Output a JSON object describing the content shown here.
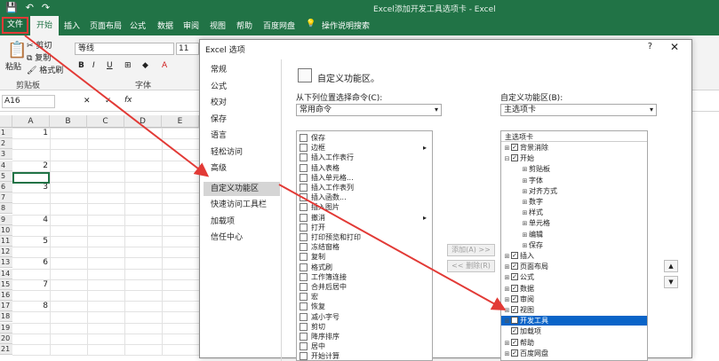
{
  "window_title": "Excel添加开发工具选项卡 - Excel",
  "qat": {
    "save": "💾",
    "undo": "↶",
    "redo": "↷"
  },
  "tabs": {
    "file": "文件",
    "home": "开始",
    "insert": "插入",
    "layout": "页面布局",
    "formulas": "公式",
    "data": "数据",
    "review": "审阅",
    "view": "视图",
    "help": "帮助",
    "baidu": "百度网盘",
    "tellme": "操作说明搜索"
  },
  "ribbon": {
    "paste": "粘贴",
    "cut": "剪切",
    "copy": "复制",
    "format_painter": "格式刷",
    "clipboard_group": "剪贴板",
    "font_name": "等线",
    "font_size": "11",
    "font_group": "字体",
    "bold": "B",
    "italic": "I",
    "underline": "U",
    "font_color": "A"
  },
  "formula": {
    "namebox": "A16",
    "cancel": "✕",
    "enter": "✓",
    "fx": "fx"
  },
  "sheet": {
    "columns": [
      "A",
      "B",
      "C",
      "D",
      "E"
    ],
    "rows": [
      "1",
      "2",
      "3",
      "4",
      "5",
      "6",
      "7",
      "8",
      "9",
      "10",
      "11",
      "12",
      "13",
      "14",
      "15",
      "16",
      "17",
      "18",
      "19",
      "20",
      "21"
    ],
    "values": [
      {
        "row": 1,
        "value": "1"
      },
      {
        "row": 4,
        "value": "2"
      },
      {
        "row": 6,
        "value": "3"
      },
      {
        "row": 9,
        "value": "4"
      },
      {
        "row": 11,
        "value": "5"
      },
      {
        "row": 13,
        "value": "6"
      },
      {
        "row": 15,
        "value": "7"
      },
      {
        "row": 17,
        "value": "8"
      }
    ]
  },
  "dialog": {
    "title": "Excel 选项",
    "help": "?",
    "close": "✕",
    "nav": [
      "常规",
      "公式",
      "校对",
      "保存",
      "语言",
      "轻松访问",
      "高级",
      "自定义功能区",
      "快速访问工具栏",
      "加载项",
      "信任中心"
    ],
    "header": "自定义功能区。",
    "left_label": "从下列位置选择命令(C):",
    "left_combo": "常用命令",
    "commands": [
      "保存",
      "边框",
      "插入工作表行",
      "插入表格",
      "插入单元格...",
      "插入工作表列",
      "插入函数...",
      "插入图片",
      "撤消",
      "打开",
      "打印预览和打印",
      "冻结窗格",
      "复制",
      "格式刷",
      "工作簿连接",
      "合并后居中",
      "宏",
      "恢复",
      "减小字号",
      "剪切",
      "降序排序",
      "居中",
      "开始计算"
    ],
    "add_button": "添加(A) >>",
    "remove_button": "<< 删除(R)",
    "right_label": "自定义功能区(B):",
    "right_combo": "主选项卡",
    "tree_header": "主选项卡",
    "tree": [
      {
        "label": "背景消除",
        "level": 0,
        "exp": "⊞",
        "checked": true
      },
      {
        "label": "开始",
        "level": 0,
        "exp": "⊟",
        "checked": true
      },
      {
        "label": "剪贴板",
        "level": 1,
        "exp": "⊞"
      },
      {
        "label": "字体",
        "level": 1,
        "exp": "⊞"
      },
      {
        "label": "对齐方式",
        "level": 1,
        "exp": "⊞"
      },
      {
        "label": "数字",
        "level": 1,
        "exp": "⊞"
      },
      {
        "label": "样式",
        "level": 1,
        "exp": "⊞"
      },
      {
        "label": "单元格",
        "level": 1,
        "exp": "⊞"
      },
      {
        "label": "编辑",
        "level": 1,
        "exp": "⊞"
      },
      {
        "label": "保存",
        "level": 1,
        "exp": "⊞"
      },
      {
        "label": "插入",
        "level": 0,
        "exp": "⊞",
        "checked": true
      },
      {
        "label": "页面布局",
        "level": 0,
        "exp": "⊞",
        "checked": true
      },
      {
        "label": "公式",
        "level": 0,
        "exp": "⊞",
        "checked": true
      },
      {
        "label": "数据",
        "level": 0,
        "exp": "⊞",
        "checked": true
      },
      {
        "label": "审阅",
        "level": 0,
        "exp": "⊞",
        "checked": true
      },
      {
        "label": "视图",
        "level": 0,
        "exp": "⊞",
        "checked": true
      },
      {
        "label": "开发工具",
        "level": 0,
        "exp": "⊞",
        "checked": true,
        "highlight": true
      },
      {
        "label": "加载项",
        "level": 0,
        "exp": "",
        "checked": true
      },
      {
        "label": "帮助",
        "level": 0,
        "exp": "⊞",
        "checked": true
      },
      {
        "label": "百度网盘",
        "level": 0,
        "exp": "⊞",
        "checked": true
      }
    ],
    "move_up": "▲",
    "move_down": "▼"
  },
  "colors": {
    "excel_green": "#217346",
    "annotation_red": "#e23a36",
    "selection_blue": "#0a64c8"
  }
}
